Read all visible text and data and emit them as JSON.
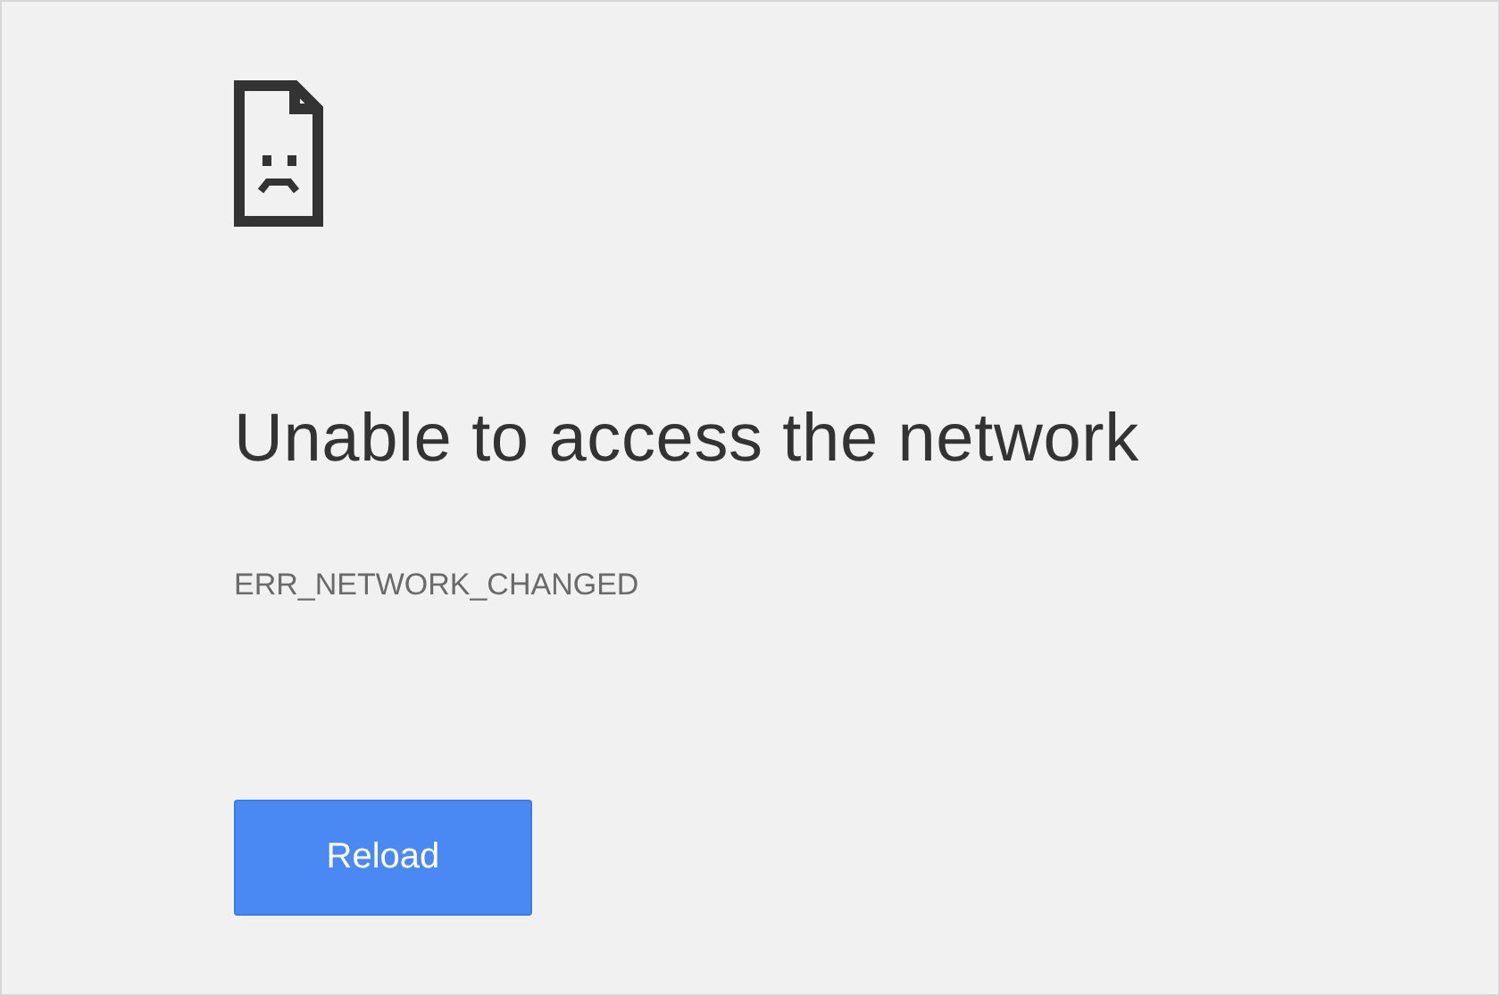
{
  "error_page": {
    "title": "Unable to access the network",
    "error_code": "ERR_NETWORK_CHANGED",
    "buttons": [
      "Reload"
    ]
  }
}
